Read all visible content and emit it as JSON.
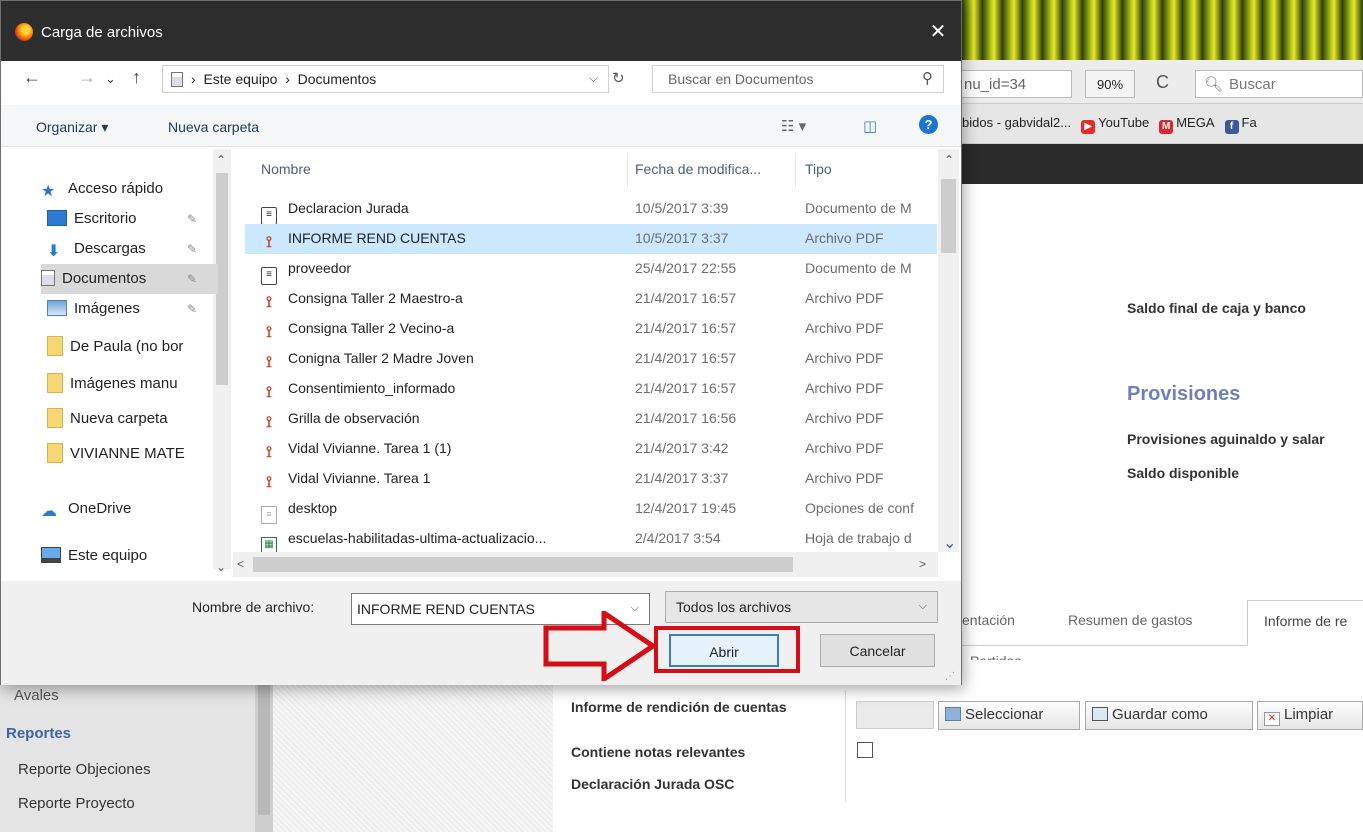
{
  "dialog": {
    "title": "Carga de archivos",
    "close_glyph": "✕",
    "nav_back": "←",
    "nav_forward": "→",
    "nav_recent": "⌄",
    "nav_up": "↑",
    "address": [
      "Este equipo",
      "Documentos"
    ],
    "address_sep": "›",
    "search_placeholder": "Buscar en Documentos",
    "toolbar": {
      "organize": "Organizar ▾",
      "new_folder": "Nueva carpeta"
    },
    "nav_pane": [
      {
        "label": "Acceso rápido",
        "icon": "star-icon"
      },
      {
        "label": "Escritorio",
        "icon": "desktop-icon",
        "pinned": true
      },
      {
        "label": "Descargas",
        "icon": "downloads-icon",
        "pinned": true
      },
      {
        "label": "Documentos",
        "icon": "documents-icon",
        "pinned": true,
        "selected": true
      },
      {
        "label": "Imágenes",
        "icon": "pictures-icon",
        "pinned": true
      },
      {
        "label": "De Paula (no bor",
        "icon": "folder-icon"
      },
      {
        "label": "Imágenes manu",
        "icon": "folder-icon"
      },
      {
        "label": "Nueva carpeta",
        "icon": "folder-icon"
      },
      {
        "label": "VIVIANNE MATE",
        "icon": "folder-icon"
      },
      {
        "label": "OneDrive",
        "icon": "onedrive-icon"
      },
      {
        "label": "Este equipo",
        "icon": "computer-icon"
      }
    ],
    "columns": {
      "name": "Nombre",
      "date": "Fecha de modifica...",
      "type": "Tipo"
    },
    "files": [
      {
        "name": "Declaracion Jurada",
        "date": "10/5/2017 3:39",
        "type": "Documento de M",
        "icon": "doc"
      },
      {
        "name": "INFORME REND CUENTAS",
        "date": "10/5/2017 3:37",
        "type": "Archivo PDF",
        "icon": "pdf",
        "selected": true
      },
      {
        "name": "proveedor",
        "date": "25/4/2017 22:55",
        "type": "Documento de M",
        "icon": "doc"
      },
      {
        "name": "Consigna Taller 2 Maestro-a",
        "date": "21/4/2017 16:57",
        "type": "Archivo PDF",
        "icon": "pdf"
      },
      {
        "name": "Consigna Taller 2 Vecino-a",
        "date": "21/4/2017 16:57",
        "type": "Archivo PDF",
        "icon": "pdf"
      },
      {
        "name": "Conigna Taller 2 Madre Joven",
        "date": "21/4/2017 16:57",
        "type": "Archivo PDF",
        "icon": "pdf"
      },
      {
        "name": "Consentimiento_informado",
        "date": "21/4/2017 16:57",
        "type": "Archivo PDF",
        "icon": "pdf"
      },
      {
        "name": "Grilla de observación",
        "date": "21/4/2017 16:56",
        "type": "Archivo PDF",
        "icon": "pdf"
      },
      {
        "name": "Vidal Vivianne. Tarea 1 (1)",
        "date": "21/4/2017 3:42",
        "type": "Archivo PDF",
        "icon": "pdf"
      },
      {
        "name": "Vidal Vivianne. Tarea 1",
        "date": "21/4/2017 3:37",
        "type": "Archivo PDF",
        "icon": "pdf"
      },
      {
        "name": "desktop",
        "date": "12/4/2017 19:45",
        "type": "Opciones de conf",
        "icon": "cfg"
      },
      {
        "name": "escuelas-habilitadas-ultima-actualizacio...",
        "date": "2/4/2017 3:54",
        "type": "Hoja de trabajo d",
        "icon": "xls"
      }
    ],
    "filename_label": "Nombre de archivo:",
    "filename_value": "INFORME REND CUENTAS",
    "filter_value": "Todos los archivos",
    "open_button": "Abrir",
    "cancel_button": "Cancelar"
  },
  "browser": {
    "url_tail": "nu_id=34",
    "zoom": "90%",
    "reload_glyph": "C",
    "search_placeholder": "Buscar",
    "bookmarks": [
      {
        "label": "bidos - gabvidal2...",
        "icon": ""
      },
      {
        "label": "YouTube",
        "icon": "youtube-icon",
        "color": "#e52d27",
        "glyph": "▶"
      },
      {
        "label": "MEGA",
        "icon": "mega-icon",
        "color": "#d9272e",
        "glyph": "M"
      },
      {
        "label": "Fa",
        "icon": "facebook-icon",
        "color": "#3b5998",
        "glyph": "f"
      }
    ]
  },
  "page": {
    "saldo_final": "Saldo final de caja y banco",
    "provisiones_heading": "Provisiones",
    "provisiones_aguinaldo": "Provisiones aguinaldo y salar",
    "saldo_disponible": "Saldo disponible",
    "tabs": [
      "entación",
      "Resumen de gastos",
      "Informe de re"
    ],
    "subtab": "Partidas",
    "sidebar": {
      "truncated_item": "Avales",
      "section": "Reportes",
      "items": [
        "Reporte Objeciones",
        "Reporte Proyecto"
      ]
    },
    "form": {
      "informe_label": "Informe de rendición de cuentas",
      "notas_label": "Contiene notas relevantes",
      "declaracion_label": "Declaración Jurada OSC",
      "select_button": "Seleccionar",
      "save_button": "Guardar como",
      "clear_button": "Limpiar"
    }
  },
  "annotation": {
    "arrow_color": "#d40d16"
  }
}
